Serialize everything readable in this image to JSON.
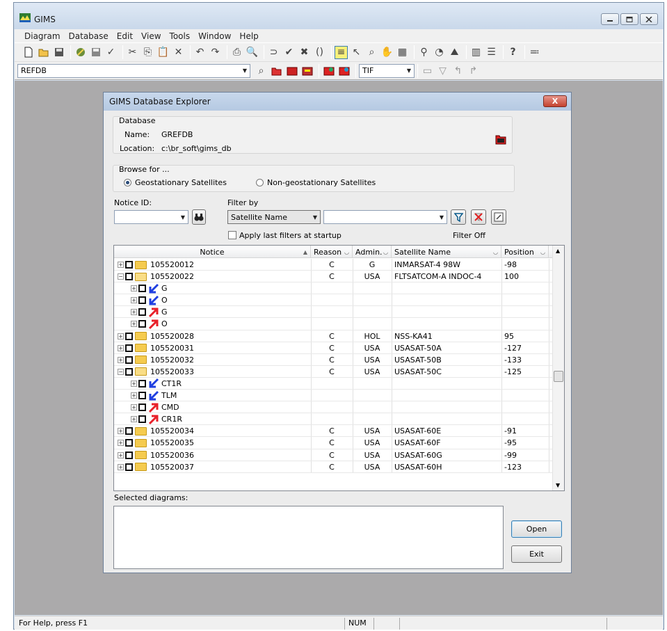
{
  "app": {
    "title": "GIMS",
    "menu": [
      "Diagram",
      "Database",
      "Edit",
      "View",
      "Tools",
      "Window",
      "Help"
    ],
    "db_combo_value": "REFDB",
    "format_combo_value": "TIF",
    "status": {
      "help": "For Help, press F1",
      "num": "NUM"
    }
  },
  "dialog": {
    "title": "GIMS Database Explorer",
    "close_label": "X",
    "database": {
      "group_title": "Database",
      "name_label": "Name:",
      "name_value": "GREFDB",
      "location_label": "Location:",
      "location_value": "c:\\br_soft\\gims_db"
    },
    "browse": {
      "group_title": "Browse for ...",
      "option_geo": "Geostationary Satellites",
      "option_nongeo": "Non-geostationary Satellites",
      "selected": "Geostationary Satellites"
    },
    "notice_id_label": "Notice ID:",
    "notice_id_value": "",
    "filter_by_label": "Filter by",
    "filter_field_value": "Satellite Name",
    "filter_value": "",
    "apply_last_filters_label": "Apply last filters at startup",
    "apply_last_filters_checked": false,
    "filter_status": "Filter Off",
    "grid": {
      "columns": [
        "Notice",
        "Reason",
        "Admin.",
        "Satellite Name",
        "Position"
      ],
      "rows": [
        {
          "level": 0,
          "expand": "+",
          "type": "folder",
          "notice": "105520012",
          "reason": "C",
          "admin": "G",
          "satellite": "INMARSAT-4 98W",
          "position": "-98"
        },
        {
          "level": 0,
          "expand": "-",
          "type": "folder-open",
          "notice": "105520022",
          "reason": "C",
          "admin": "USA",
          "satellite": "FLTSATCOM-A INDOC-4",
          "position": "100"
        },
        {
          "level": 1,
          "expand": "+",
          "type": "down-arrow",
          "notice": "G",
          "reason": "",
          "admin": "",
          "satellite": "",
          "position": ""
        },
        {
          "level": 1,
          "expand": "+",
          "type": "down-arrow",
          "notice": "O",
          "reason": "",
          "admin": "",
          "satellite": "",
          "position": ""
        },
        {
          "level": 1,
          "expand": "+",
          "type": "up-arrow",
          "notice": "G",
          "reason": "",
          "admin": "",
          "satellite": "",
          "position": ""
        },
        {
          "level": 1,
          "expand": "+",
          "type": "up-arrow",
          "notice": "O",
          "reason": "",
          "admin": "",
          "satellite": "",
          "position": ""
        },
        {
          "level": 0,
          "expand": "+",
          "type": "folder",
          "notice": "105520028",
          "reason": "C",
          "admin": "HOL",
          "satellite": "NSS-KA41",
          "position": "95"
        },
        {
          "level": 0,
          "expand": "+",
          "type": "folder",
          "notice": "105520031",
          "reason": "C",
          "admin": "USA",
          "satellite": "USASAT-50A",
          "position": "-127"
        },
        {
          "level": 0,
          "expand": "+",
          "type": "folder",
          "notice": "105520032",
          "reason": "C",
          "admin": "USA",
          "satellite": "USASAT-50B",
          "position": "-133"
        },
        {
          "level": 0,
          "expand": "-",
          "type": "folder-open",
          "notice": "105520033",
          "reason": "C",
          "admin": "USA",
          "satellite": "USASAT-50C",
          "position": "-125"
        },
        {
          "level": 1,
          "expand": "+",
          "type": "down-arrow",
          "notice": "CT1R",
          "reason": "",
          "admin": "",
          "satellite": "",
          "position": ""
        },
        {
          "level": 1,
          "expand": "+",
          "type": "down-arrow",
          "notice": "TLM",
          "reason": "",
          "admin": "",
          "satellite": "",
          "position": ""
        },
        {
          "level": 1,
          "expand": "+",
          "type": "up-arrow",
          "notice": "CMD",
          "reason": "",
          "admin": "",
          "satellite": "",
          "position": ""
        },
        {
          "level": 1,
          "expand": "+",
          "type": "up-arrow",
          "notice": "CR1R",
          "reason": "",
          "admin": "",
          "satellite": "",
          "position": ""
        },
        {
          "level": 0,
          "expand": "+",
          "type": "folder",
          "notice": "105520034",
          "reason": "C",
          "admin": "USA",
          "satellite": "USASAT-60E",
          "position": "-91"
        },
        {
          "level": 0,
          "expand": "+",
          "type": "folder",
          "notice": "105520035",
          "reason": "C",
          "admin": "USA",
          "satellite": "USASAT-60F",
          "position": "-95"
        },
        {
          "level": 0,
          "expand": "+",
          "type": "folder",
          "notice": "105520036",
          "reason": "C",
          "admin": "USA",
          "satellite": "USASAT-60G",
          "position": "-99"
        },
        {
          "level": 0,
          "expand": "+",
          "type": "folder",
          "notice": "105520037",
          "reason": "C",
          "admin": "USA",
          "satellite": "USASAT-60H",
          "position": "-123"
        }
      ]
    },
    "selected_diagrams_label": "Selected diagrams:",
    "open_label": "Open",
    "exit_label": "Exit"
  },
  "colors": {
    "workspace": "#abaaab",
    "down_arrow": "#1f3fe0",
    "up_arrow": "#e8202a",
    "folder": "#f5cb4f"
  }
}
